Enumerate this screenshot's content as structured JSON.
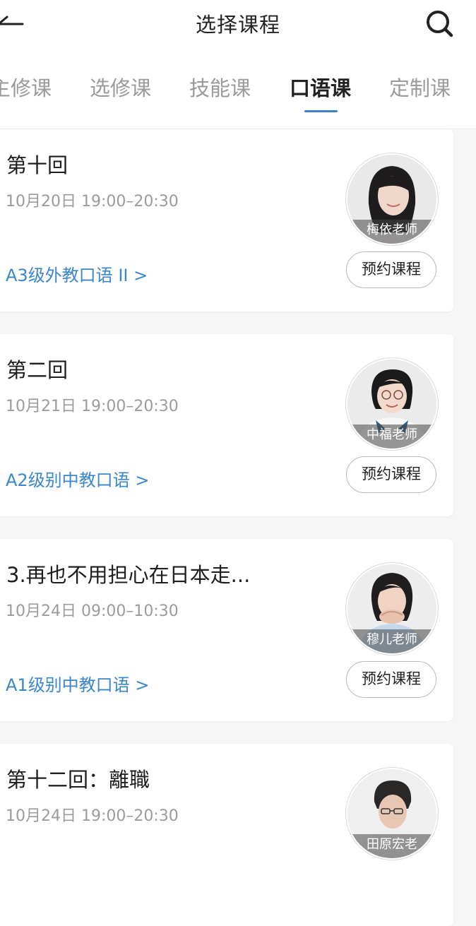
{
  "header": {
    "title": "选择课程"
  },
  "tabs": [
    {
      "label": "主修课",
      "active": false
    },
    {
      "label": "选修课",
      "active": false
    },
    {
      "label": "技能课",
      "active": false
    },
    {
      "label": "口语课",
      "active": true
    },
    {
      "label": "定制课",
      "active": false
    }
  ],
  "lessons": [
    {
      "title": "第十回",
      "time": "10月20日 19:00–20:30",
      "course": "A3级外教口语 II  >",
      "teacher": "梅依老师",
      "book_label": "预约课程"
    },
    {
      "title": "第二回",
      "time": "10月21日 19:00–20:30",
      "course": "A2级别中教口语 >",
      "teacher": "中福老师",
      "book_label": "预约课程"
    },
    {
      "title": "3.再也不用担心在日本走...",
      "time": "10月24日 09:00–10:30",
      "course": "A1级别中教口语 >",
      "teacher": "穆儿老师",
      "book_label": "预约课程"
    },
    {
      "title": "第十二回：離職",
      "time": "10月24日 19:00–20:30",
      "course": "",
      "teacher": "田原宏老",
      "book_label": ""
    }
  ],
  "colors": {
    "accent": "#3a86cc",
    "background": "#f6f6f7"
  }
}
